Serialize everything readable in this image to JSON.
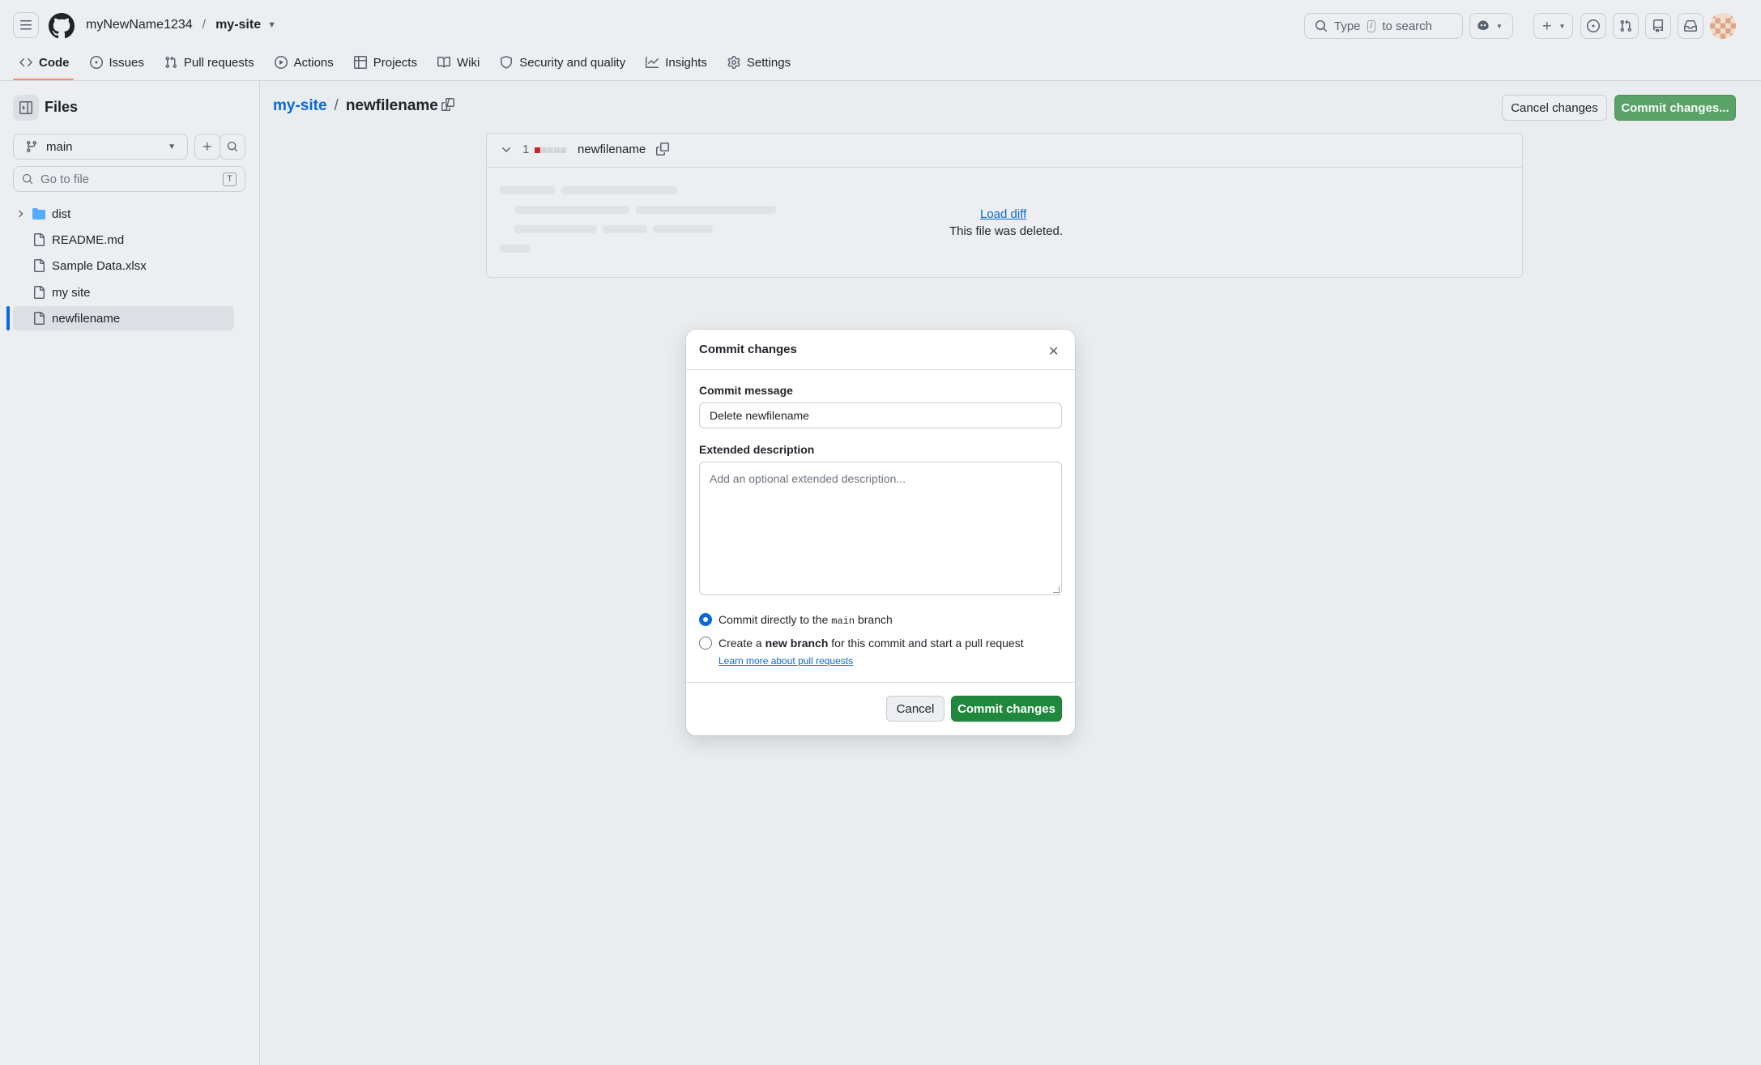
{
  "header": {
    "owner": "myNewName1234",
    "separator": "/",
    "repo": "my-site",
    "search_prefix": "Type",
    "search_key": "/",
    "search_suffix": "to search"
  },
  "tabs": [
    {
      "label": "Code",
      "icon": "code-icon"
    },
    {
      "label": "Issues",
      "icon": "issue-opened-icon"
    },
    {
      "label": "Pull requests",
      "icon": "git-pull-request-icon"
    },
    {
      "label": "Actions",
      "icon": "play-icon"
    },
    {
      "label": "Projects",
      "icon": "table-icon"
    },
    {
      "label": "Wiki",
      "icon": "book-icon"
    },
    {
      "label": "Security and quality",
      "icon": "shield-icon"
    },
    {
      "label": "Insights",
      "icon": "graph-icon"
    },
    {
      "label": "Settings",
      "icon": "gear-icon"
    }
  ],
  "sidebar": {
    "title": "Files",
    "branch": "main",
    "goto_placeholder": "Go to file",
    "goto_key": "T",
    "items": [
      {
        "label": "dist",
        "type": "folder"
      },
      {
        "label": "README.md",
        "type": "file"
      },
      {
        "label": "Sample Data.xlsx",
        "type": "file"
      },
      {
        "label": "my site",
        "type": "file"
      },
      {
        "label": "newfilename",
        "type": "file",
        "selected": true
      }
    ]
  },
  "main": {
    "breadcrumb_repo": "my-site",
    "breadcrumb_file": "newfilename",
    "breadcrumb_sep": "/",
    "cancel_label": "Cancel changes",
    "commit_label": "Commit changes...",
    "diff": {
      "count": "1",
      "filename": "newfilename",
      "load_diff": "Load diff",
      "deleted_text": "This file was deleted."
    }
  },
  "dialog": {
    "title": "Commit changes",
    "message_label": "Commit message",
    "message_value": "Delete newfilename",
    "description_label": "Extended description",
    "description_placeholder": "Add an optional extended description...",
    "option1_pre": "Commit directly to the",
    "option1_branch": "main",
    "option1_post": "branch",
    "option2_pre": "Create a",
    "option2_bold": "new branch",
    "option2_post": "for this commit and start a pull request",
    "learn_more": "Learn more about pull requests",
    "cancel": "Cancel",
    "commit": "Commit changes"
  },
  "colors": {
    "accent": "#0969da",
    "primary_green": "#1f883d",
    "deleted_red": "#cf222e",
    "active_tab_underline": "#fd8c73"
  }
}
